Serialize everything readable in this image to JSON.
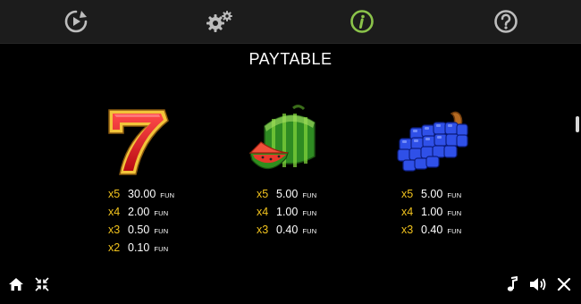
{
  "title": "PAYTABLE",
  "toolbar": {
    "icons": [
      "replay-icon",
      "settings-gear-icon",
      "info-icon",
      "help-question-icon"
    ],
    "active": "info-icon",
    "active_color": "#8bc34a",
    "icon_color": "#bdbdbd"
  },
  "symbols": [
    {
      "name": "seven",
      "payouts": [
        {
          "mult": "x5",
          "value": "30.00",
          "unit": "FUN"
        },
        {
          "mult": "x4",
          "value": "2.00",
          "unit": "FUN"
        },
        {
          "mult": "x3",
          "value": "0.50",
          "unit": "FUN"
        },
        {
          "mult": "x2",
          "value": "0.10",
          "unit": "FUN"
        }
      ]
    },
    {
      "name": "watermelon",
      "payouts": [
        {
          "mult": "x5",
          "value": "5.00",
          "unit": "FUN"
        },
        {
          "mult": "x4",
          "value": "1.00",
          "unit": "FUN"
        },
        {
          "mult": "x3",
          "value": "0.40",
          "unit": "FUN"
        }
      ]
    },
    {
      "name": "grapes",
      "payouts": [
        {
          "mult": "x5",
          "value": "5.00",
          "unit": "FUN"
        },
        {
          "mult": "x4",
          "value": "1.00",
          "unit": "FUN"
        },
        {
          "mult": "x3",
          "value": "0.40",
          "unit": "FUN"
        }
      ]
    }
  ],
  "colors": {
    "multiplier": "#f2c31d",
    "background": "#000000",
    "topbar": "#1c1c1c"
  },
  "bottom_bar": {
    "left": [
      "home-icon",
      "minimize-icon"
    ],
    "right": [
      "music-icon",
      "sound-icon",
      "close-icon"
    ]
  }
}
